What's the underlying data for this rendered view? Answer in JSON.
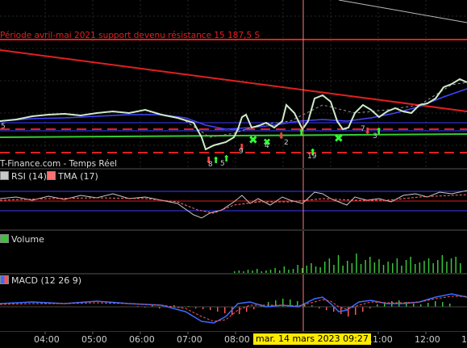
{
  "price_panel": {
    "annotation": "Période avril-mai 2021 support devenu résistance 15 187,5 S",
    "source": "T-Finance.com - Temps Réel",
    "labels_under": [
      "8",
      "5",
      "9",
      "4",
      "2",
      "19",
      "7",
      "3"
    ],
    "left_edge_label": "5"
  },
  "rsi_panel": {
    "rsi_legend": "RSI (14)",
    "tma_legend": "TMA (17)",
    "rsi_color": "#c8c8c8",
    "tma_color": "#ff7070"
  },
  "volume_panel": {
    "legend": "Volume",
    "bar_color": "#39c439"
  },
  "macd_panel": {
    "legend": "MACD (12 26 9)"
  },
  "time_axis": {
    "labels": [
      "04:00",
      "05:00",
      "06:00",
      "07:00",
      "08:00",
      "11:00",
      "12:00",
      "1"
    ],
    "cursor_label": "mar. 14 mars 2023 09:27"
  },
  "colors": {
    "background": "#000000",
    "resistance": "#e02020",
    "support": "#33cc33",
    "ma_blue": "#3a3aff",
    "grid": "#262626",
    "cursor": "#ff7a7a"
  }
}
